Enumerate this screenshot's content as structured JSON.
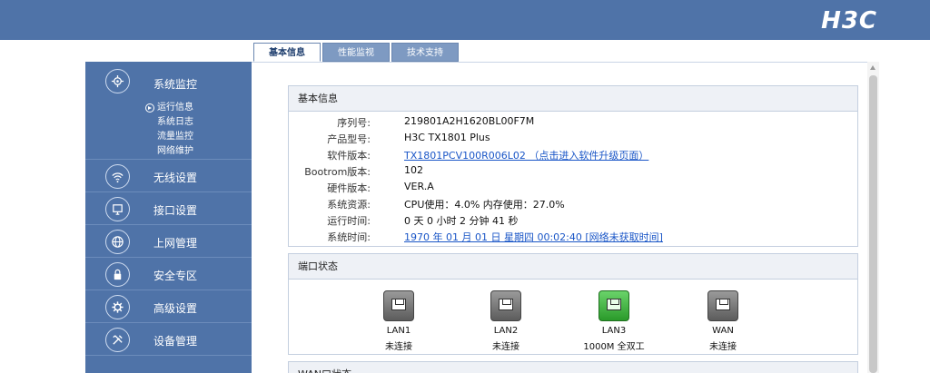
{
  "header": {
    "logo": "H3C"
  },
  "tabs": [
    {
      "label": "基本信息",
      "active": true
    },
    {
      "label": "性能监视",
      "active": false
    },
    {
      "label": "技术支持",
      "active": false
    }
  ],
  "sidebar": {
    "items": [
      {
        "label": "系统监控",
        "icon": "gear-network-icon"
      },
      {
        "label": "无线设置",
        "icon": "wifi-icon"
      },
      {
        "label": "接口设置",
        "icon": "interface-icon"
      },
      {
        "label": "上网管理",
        "icon": "globe-icon"
      },
      {
        "label": "安全专区",
        "icon": "lock-icon"
      },
      {
        "label": "高级设置",
        "icon": "gear-icon"
      },
      {
        "label": "设备管理",
        "icon": "tools-icon"
      }
    ],
    "subitems": [
      "运行信息",
      "系统日志",
      "流量监控",
      "网络维护"
    ]
  },
  "basic_info": {
    "title": "基本信息",
    "rows": [
      {
        "label": "序列号:",
        "value": "219801A2H1620BL00F7M"
      },
      {
        "label": "产品型号:",
        "value": "H3C TX1801 Plus"
      },
      {
        "label": "软件版本:",
        "value": "TX1801PCV100R006L02 （点击进入软件升级页面）"
      },
      {
        "label": "Bootrom版本:",
        "value": "102"
      },
      {
        "label": "硬件版本:",
        "value": "VER.A"
      },
      {
        "label": "系统资源:",
        "value": "CPU使用：4.0%   内存使用：27.0%"
      },
      {
        "label": "运行时间:",
        "value": "0 天 0 小时 2 分钟 41 秒"
      },
      {
        "label": "系统时间:",
        "value": "1970 年 01 月 01 日 星期四 00:02:40 [网络未获取时间]"
      }
    ]
  },
  "port_status": {
    "title": "端口状态",
    "ports": [
      {
        "name": "LAN1",
        "status": "未连接"
      },
      {
        "name": "LAN2",
        "status": "未连接"
      },
      {
        "name": "LAN3",
        "status": "1000M 全双工"
      },
      {
        "name": "WAN",
        "status": "未连接"
      }
    ]
  },
  "wan_status": {
    "title": "WAN口状态"
  },
  "colors": {
    "header": "#4f73a8",
    "sidebar": "#4f73a8",
    "link": "#1a56c7",
    "port_connected": "#3cb43c"
  }
}
